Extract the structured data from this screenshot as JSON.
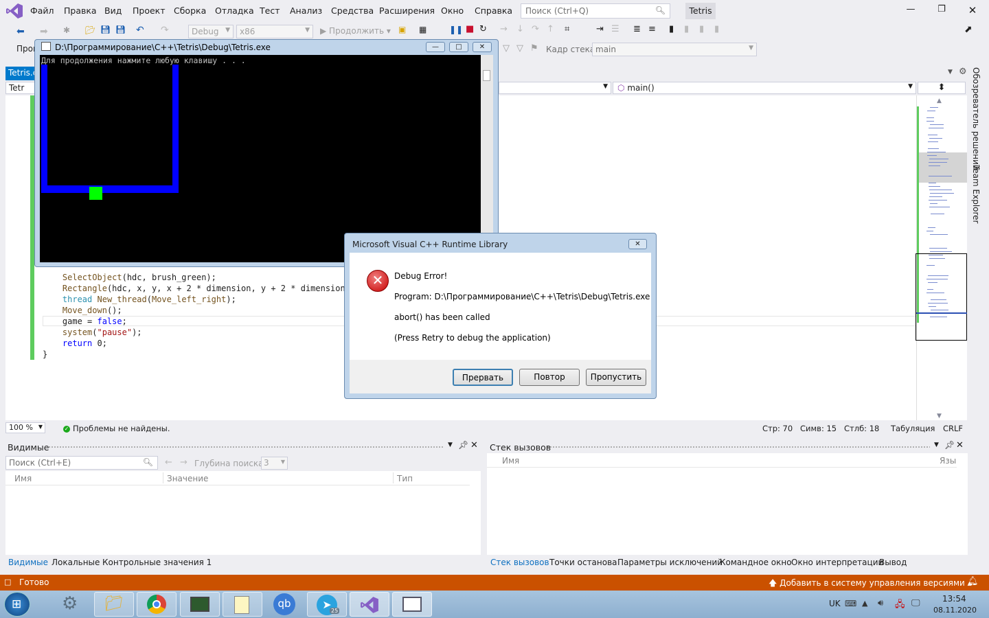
{
  "menu": {
    "items": [
      "Файл",
      "Правка",
      "Вид",
      "Проект",
      "Сборка",
      "Отладка",
      "Тест",
      "Анализ",
      "Средства",
      "Расширения",
      "Окно",
      "Справка"
    ],
    "search_placeholder": "Поиск (Ctrl+Q)",
    "solution_name": "Tetris"
  },
  "toolbar": {
    "config": "Debug",
    "platform": "x86",
    "continue_label": "Продолжить",
    "process_label": "Проц",
    "stack_frame_label": "Кадр стека:",
    "stack_frame_value": "main"
  },
  "editor": {
    "doc_tab": "Tetris.c",
    "nav_left": "Tetr",
    "nav_function": "main()",
    "code_lines": [
      {
        "indent": "    ",
        "parts": [
          {
            "t": "SelectObject",
            "c": "fn"
          },
          {
            "t": "(hdc, brush_green);",
            "c": ""
          }
        ]
      },
      {
        "indent": "    ",
        "parts": [
          {
            "t": "Rectangle",
            "c": "fn"
          },
          {
            "t": "(hdc, x, y, x + 2 * dimension, y + 2 * dimension);",
            "c": ""
          }
        ]
      },
      {
        "indent": "    ",
        "parts": [
          {
            "t": "thread",
            "c": "ty"
          },
          {
            "t": " ",
            "c": ""
          },
          {
            "t": "New_thread",
            "c": "fn"
          },
          {
            "t": "(",
            "c": ""
          },
          {
            "t": "Move_left_right",
            "c": "fn"
          },
          {
            "t": ");",
            "c": ""
          }
        ]
      },
      {
        "indent": "    ",
        "parts": [
          {
            "t": "Move_down",
            "c": "fn"
          },
          {
            "t": "();",
            "c": ""
          }
        ]
      },
      {
        "indent": "    ",
        "parts": [
          {
            "t": "game = ",
            "c": ""
          },
          {
            "t": "false",
            "c": "kw"
          },
          {
            "t": ";",
            "c": ""
          }
        ]
      },
      {
        "indent": "    ",
        "parts": [
          {
            "t": "system",
            "c": "fn"
          },
          {
            "t": "(",
            "c": ""
          },
          {
            "t": "\"pause\"",
            "c": "str"
          },
          {
            "t": ");",
            "c": ""
          }
        ]
      },
      {
        "indent": "    ",
        "parts": [
          {
            "t": "return",
            "c": "kw"
          },
          {
            "t": " 0;",
            "c": ""
          }
        ]
      },
      {
        "indent": "",
        "parts": [
          {
            "t": "}",
            "c": ""
          }
        ]
      }
    ],
    "zoom": "100 %",
    "issues": "Проблемы не найдены.",
    "line": "Стр: 70",
    "char": "Симв: 15",
    "col": "Стлб: 18",
    "tabs": "Табуляция",
    "eol": "CRLF"
  },
  "side_tabs": [
    "Обозреватель решений",
    "Team Explorer"
  ],
  "watch_panel": {
    "title": "Видимые",
    "search_placeholder": "Поиск (Ctrl+E)",
    "depth_label": "Глубина поиска:",
    "depth_value": "3",
    "columns": [
      "Имя",
      "Значение",
      "Тип"
    ],
    "tabs": [
      "Видимые",
      "Локальные",
      "Контрольные значения 1"
    ]
  },
  "callstack_panel": {
    "title": "Стек вызовов",
    "columns": [
      "Имя",
      "Язы"
    ],
    "tabs": [
      "Стек вызовов",
      "Точки останова",
      "Параметры исключений",
      "Командное окно",
      "Окно интерпретации",
      "Вывод"
    ]
  },
  "statusbar": {
    "ready": "Готово",
    "vcs": "Добавить в систему управления версиями"
  },
  "taskbar": {
    "lang": "UK",
    "time": "13:54",
    "date": "08.11.2020",
    "telegram_badge": "25"
  },
  "console": {
    "title": "D:\\Программирование\\C++\\Tetris\\Debug\\Tetris.exe",
    "text": "Для продолжения нажмите любую клавишу . . ."
  },
  "dialog": {
    "title": "Microsoft Visual C++ Runtime Library",
    "heading": "Debug Error!",
    "program": "Program: D:\\Программирование\\C++\\Tetris\\Debug\\Tetris.exe",
    "message": "abort() has been called",
    "hint": "(Press Retry to debug the application)",
    "buttons": [
      "Прервать",
      "Повтор",
      "Пропустить"
    ]
  },
  "colors": {
    "accent": "#007ACC",
    "statusbar": "#CA5100",
    "console_blue": "#0000FF",
    "console_green": "#00FF00"
  }
}
